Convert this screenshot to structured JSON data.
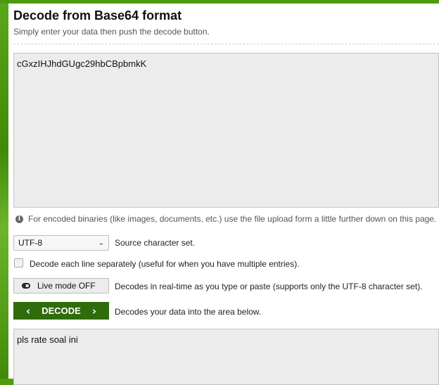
{
  "header": {
    "title": "Decode from Base64 format",
    "subtitle": "Simply enter your data then push the decode button."
  },
  "input": {
    "value": "cGxzIHJhdGUgc29hbCBpbmkK"
  },
  "info": {
    "text": "For encoded binaries (like images, documents, etc.) use the file upload form a little further down on this page."
  },
  "charset": {
    "selected": "UTF-8",
    "label": "Source character set."
  },
  "each_line": {
    "label": "Decode each line separately (useful for when you have multiple entries)."
  },
  "live_mode": {
    "button_label": "Live mode OFF",
    "description": "Decodes in real-time as you type or paste (supports only the UTF-8 character set)."
  },
  "decode": {
    "button_label": "DECODE",
    "description": "Decodes your data into the area below."
  },
  "output": {
    "value": "pls rate soal ini"
  },
  "colors": {
    "brand_green": "#4f9a0e",
    "button_green": "#2e6d0a"
  }
}
